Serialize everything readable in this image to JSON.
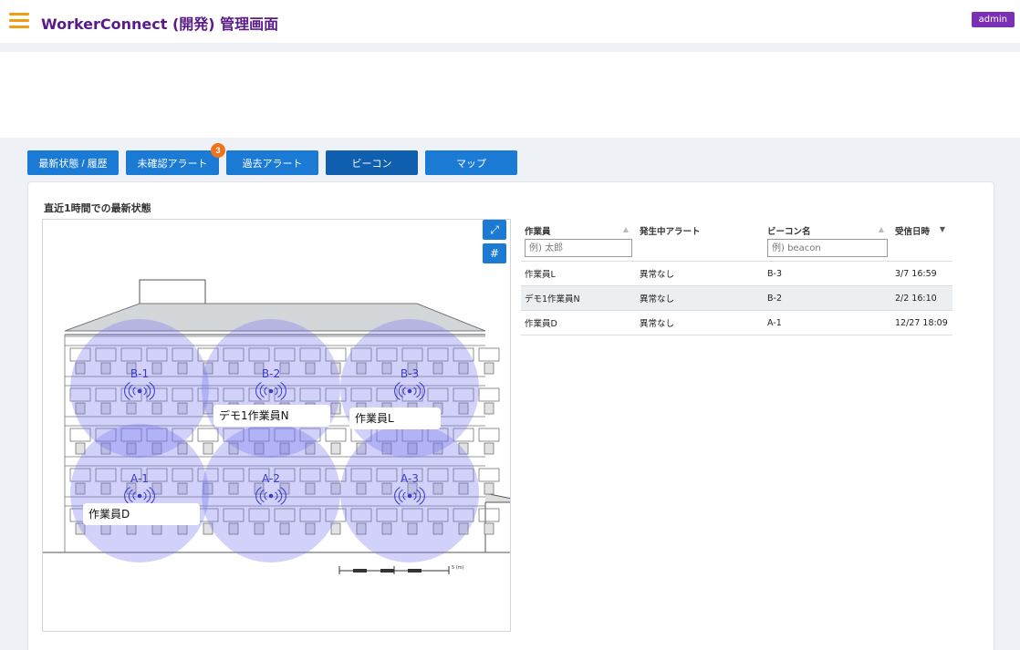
{
  "header": {
    "title": "WorkerConnect (開発) 管理画面",
    "user": "admin"
  },
  "tabs": [
    {
      "label": "最新状態 / 履歴"
    },
    {
      "label": "未確認アラート",
      "badge": "3"
    },
    {
      "label": "過去アラート"
    },
    {
      "label": "ビーコン"
    },
    {
      "label": "マップ"
    }
  ],
  "section": {
    "title": "直近1時間での最新状態"
  },
  "map": {
    "expand_icon": "⤢",
    "grid_icon": "#",
    "beacons": [
      {
        "id": "B-1"
      },
      {
        "id": "B-2"
      },
      {
        "id": "B-3"
      },
      {
        "id": "A-1"
      },
      {
        "id": "A-2"
      },
      {
        "id": "A-3"
      }
    ],
    "worker_labels": [
      {
        "name": "デモ1作業員N",
        "beacon": "B-2"
      },
      {
        "name": "作業員L",
        "beacon": "B-3"
      },
      {
        "name": "作業員D",
        "beacon": "A-1"
      }
    ],
    "scale_label": "5 (m)"
  },
  "table": {
    "columns": [
      "作業員",
      "発生中アラート",
      "ビーコン名",
      "受信日時"
    ],
    "filters": {
      "worker_placeholder": "例) 太郎",
      "beacon_placeholder": "例) beacon"
    },
    "rows": [
      {
        "worker": "作業員L",
        "alert": "異常なし",
        "beacon": "B-3",
        "received": "3/7 16:59"
      },
      {
        "worker": "デモ1作業員N",
        "alert": "異常なし",
        "beacon": "B-2",
        "received": "2/2 16:10"
      },
      {
        "worker": "作業員D",
        "alert": "異常なし",
        "beacon": "A-1",
        "received": "12/27 18:09"
      }
    ]
  },
  "colors": {
    "header_title": "#5a1a8a",
    "tab": "#1a7ad4",
    "alert_badge": "#f0731c",
    "beacon_zone": "#6f6ff0"
  }
}
